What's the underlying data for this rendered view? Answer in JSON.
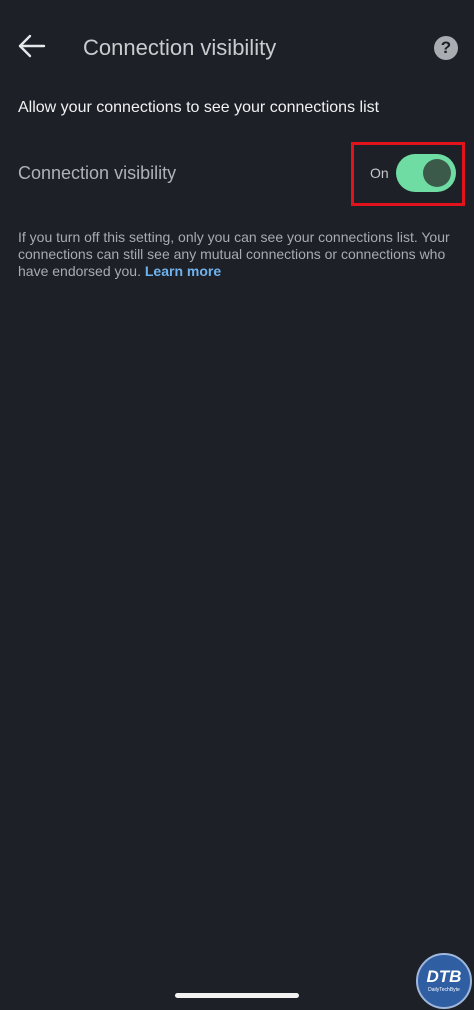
{
  "header": {
    "title": "Connection visibility",
    "back_icon": "arrow-left-icon",
    "help_icon": "question-mark-icon",
    "help_glyph": "?"
  },
  "subtitle": "Allow your connections to see your connections list",
  "setting": {
    "label": "Connection visibility",
    "state_label": "On",
    "enabled": true,
    "toggle_color": "#6fdca4",
    "highlight_color": "#e3131e"
  },
  "description": {
    "text": "If you turn off this setting, only you can see your connections list. Your connections can still see any mutual connections or connections who have endorsed you.",
    "link_label": "Learn more",
    "link_color": "#70b2ee"
  },
  "watermark": {
    "text": "DTB",
    "sub": "DailyTechByte"
  }
}
